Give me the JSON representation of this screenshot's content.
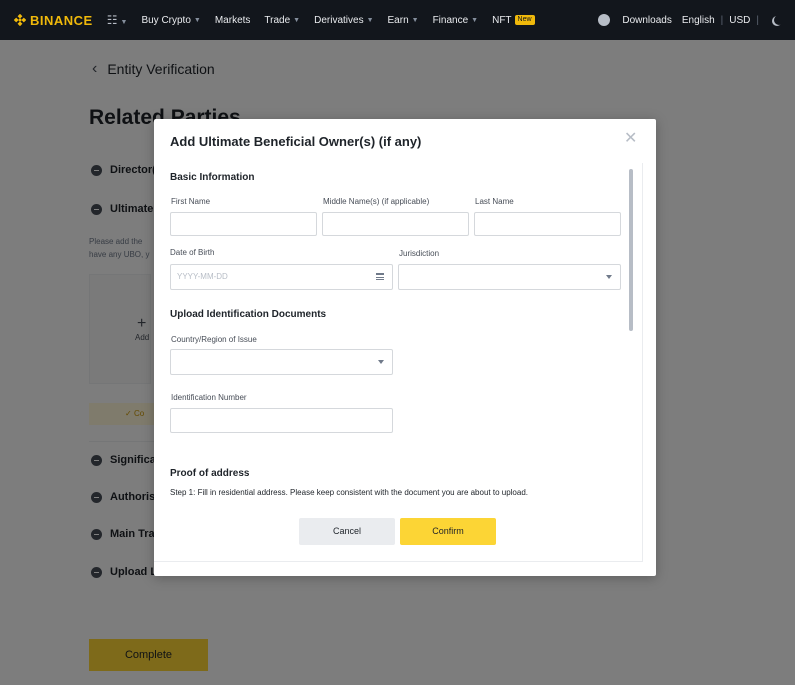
{
  "nav": {
    "brand": "BINANCE",
    "items": [
      {
        "label": "Buy Crypto",
        "caret": true
      },
      {
        "label": "Markets",
        "caret": false
      },
      {
        "label": "Trade",
        "caret": true
      },
      {
        "label": "Derivatives",
        "caret": true
      },
      {
        "label": "Earn",
        "caret": true
      },
      {
        "label": "Finance",
        "caret": true
      },
      {
        "label": "NFT",
        "caret": false
      }
    ],
    "nft_badge": "New",
    "downloads": "Downloads",
    "language": "English",
    "currency": "USD",
    "icons": [
      "binance-logo-icon",
      "apps-grid-icon",
      "user-icon",
      "moon-icon"
    ]
  },
  "background": {
    "back_label": "Entity Verification",
    "title": "Related Parties",
    "items": [
      "Director(",
      "Ultimate",
      "Significan",
      "Authorise",
      "Main Trad",
      "Upload L"
    ],
    "description": [
      "Please add the",
      "have any UBO, y"
    ],
    "add_label": "Add",
    "confirm_bar": "Co",
    "complete_button": "Complete"
  },
  "modal": {
    "title": "Add Ultimate Beneficial Owner(s) (if any)",
    "basic_info": {
      "heading": "Basic Information",
      "first_name_label": "First Name",
      "first_name_value": "",
      "middle_name_label": "Middle Name(s) (if applicable)",
      "middle_name_value": "",
      "last_name_label": "Last Name",
      "last_name_value": "",
      "dob_label": "Date of Birth",
      "dob_placeholder": "YYYY-MM-DD",
      "jurisdiction_label": "Jurisdiction",
      "jurisdiction_value": ""
    },
    "upload": {
      "heading": "Upload Identification Documents",
      "country_label": "Country/Region of Issue",
      "country_value": "",
      "id_number_label": "Identification Number",
      "id_number_value": ""
    },
    "proof": {
      "heading": "Proof of address",
      "step1": "Step 1: Fill in residential address. Please keep consistent with the document you are about to upload."
    },
    "cancel_label": "Cancel",
    "confirm_label": "Confirm",
    "colors": {
      "accent": "#fcd535",
      "brand": "#f0b90b",
      "nav_bg": "#12161c"
    }
  }
}
